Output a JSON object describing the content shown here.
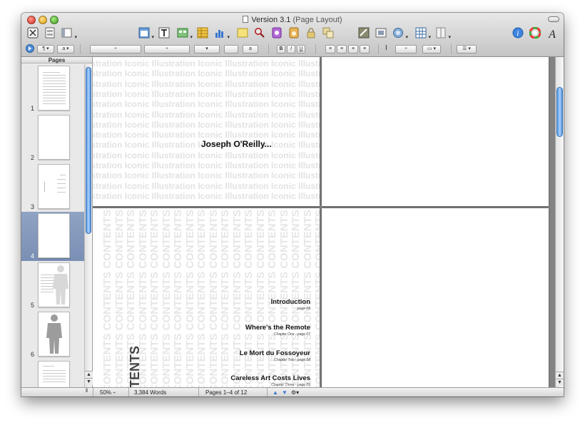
{
  "window": {
    "title": "Version 3.1",
    "subtitle": "(Page Layout)"
  },
  "toolbar": {
    "icons": [
      "view-icon",
      "sections-icon",
      "inspector-layout-icon",
      "text-box-icon",
      "shapes-icon",
      "table-icon",
      "chart-icon",
      "comment-icon",
      "search-icon",
      "media-icon",
      "adjust-icon",
      "lock-icon",
      "group-icon",
      "mask-icon",
      "front-icon",
      "wrap-icon",
      "grid-icon",
      "columns-icon",
      "info-icon",
      "colors-icon",
      "fonts-icon"
    ]
  },
  "formatbar": {
    "font_size_value": "a"
  },
  "sidebar": {
    "header": "Pages",
    "pages": [
      {
        "num": "1",
        "kind": "lines"
      },
      {
        "num": "2",
        "kind": "blank"
      },
      {
        "num": "3",
        "kind": "sparse"
      },
      {
        "num": "4",
        "kind": "blank",
        "selected": true
      },
      {
        "num": "5",
        "kind": "figure"
      },
      {
        "num": "6",
        "kind": "figure-gray"
      },
      {
        "num": "",
        "kind": "lines"
      }
    ]
  },
  "document": {
    "background_word": "Illustration Iconic ",
    "author": "Joseph O'Reilly...",
    "contents_word": "CONTENTS",
    "contents_big": "NTENTS",
    "toc": [
      {
        "title": "Introduction",
        "sub": "page 05"
      },
      {
        "title": "Where's the Remote",
        "sub": "Chapter One - page 07"
      },
      {
        "title": "Le Mort du Fossoyeur",
        "sub": "Chapter Two - page 08"
      },
      {
        "title": "Careless Art Costs Lives",
        "sub": "Chapter Three - page 09"
      }
    ]
  },
  "status": {
    "zoom": "50%",
    "words": "3,384 Words",
    "pages": "Pages 1–4 of 12"
  },
  "colors": {
    "accent": "#4f8ed8",
    "selection": "#7a8fb4"
  }
}
